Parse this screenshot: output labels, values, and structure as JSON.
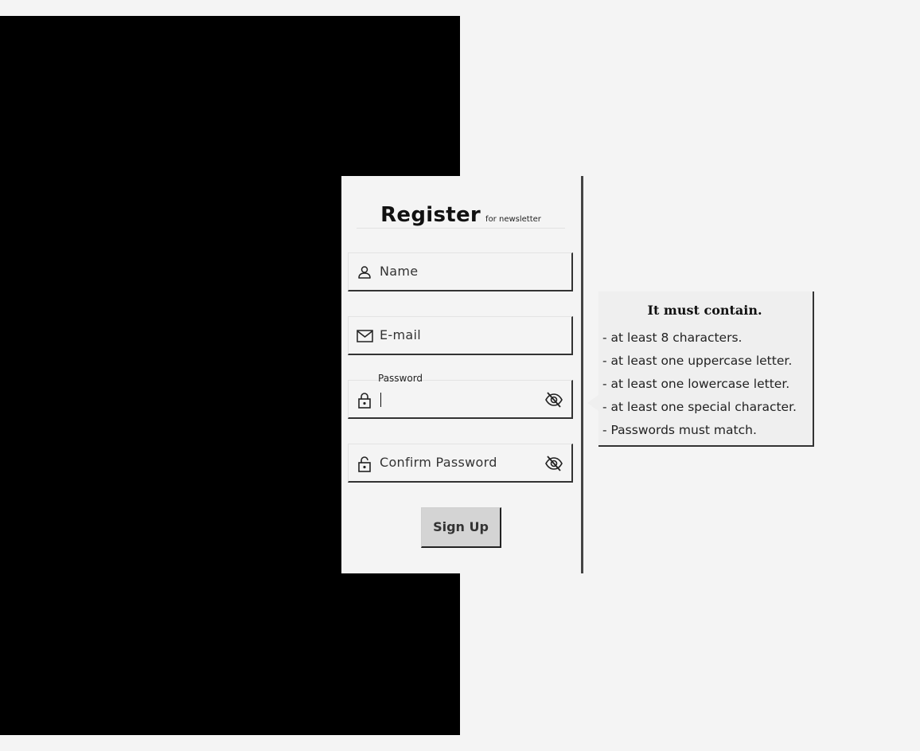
{
  "form": {
    "title": "Register",
    "subtitle": "for newsletter",
    "name_placeholder": "Name",
    "email_placeholder": "E-mail",
    "password_label": "Password",
    "password_value": "",
    "confirm_placeholder": "Confirm Password",
    "submit_label": "Sign Up"
  },
  "password_rules": {
    "title": "It must contain.",
    "items": [
      "- at least 8 characters.",
      "- at least one uppercase letter.",
      "- at least one lowercase letter.",
      "- at least one special character.",
      "- Passwords must match."
    ]
  },
  "icons": {
    "name": "user-icon",
    "email": "envelope-icon",
    "password": "lock-icon",
    "confirm": "unlock-icon",
    "visibility": "eye-slash-icon"
  },
  "colors": {
    "background": "#f4f4f4",
    "left_panel": "#000000",
    "button": "#d4d4d4",
    "border_shadow": "#333333"
  }
}
